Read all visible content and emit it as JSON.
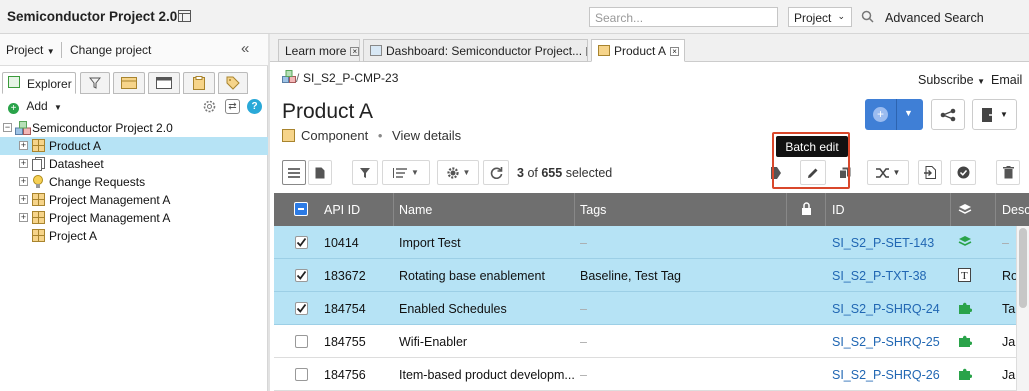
{
  "app": {
    "title": "Semiconductor Project 2.0"
  },
  "search": {
    "placeholder": "Search...",
    "scope": "Project",
    "advanced": "Advanced Search"
  },
  "left": {
    "project_menu": "Project",
    "change_project": "Change project",
    "explorer_tab": "Explorer",
    "add": "Add",
    "tree": [
      {
        "label": "Semiconductor Project 2.0",
        "icon": "project-icon",
        "level": 0,
        "expander": "−"
      },
      {
        "label": "Product A",
        "icon": "component-icon",
        "level": 1,
        "expander": "+",
        "selected": true
      },
      {
        "label": "Datasheet",
        "icon": "document-icon",
        "level": 1,
        "expander": "+"
      },
      {
        "label": "Change Requests",
        "icon": "lightbulb-icon",
        "level": 1,
        "expander": "+"
      },
      {
        "label": "Project Management A",
        "icon": "component-icon",
        "level": 1,
        "expander": "+"
      },
      {
        "label": "Project Management A",
        "icon": "component-icon",
        "level": 1,
        "expander": "+"
      },
      {
        "label": "Project A",
        "icon": "component-icon",
        "level": 1,
        "expander": ""
      }
    ]
  },
  "tabs": [
    {
      "label": "Learn more"
    },
    {
      "label": "Dashboard: Semiconductor Project..."
    },
    {
      "label": "Product A",
      "active": true
    }
  ],
  "header": {
    "breadcrumb": "SI_S2_P-CMP-23",
    "subscribe": "Subscribe",
    "email": "Email",
    "title": "Product A",
    "type": "Component",
    "separator": "•",
    "view_details": "View details"
  },
  "toolbar": {
    "selection_count": "3",
    "selection_of": "of",
    "selection_total": "655",
    "selection_word": "selected",
    "tooltip": "Batch edit"
  },
  "table": {
    "columns": [
      "API ID",
      "Name",
      "Tags",
      "",
      "ID",
      "",
      "Desc"
    ],
    "rows": [
      {
        "checked": true,
        "api_id": "10414",
        "name": "Import Test",
        "tags": "–",
        "id": "SI_S2_P-SET-143",
        "type_icon": "set-icon",
        "desc": "–"
      },
      {
        "checked": true,
        "api_id": "183672",
        "name": "Rotating base enablement",
        "tags": "Baseline, Test Tag",
        "id": "SI_S2_P-TXT-38",
        "type_icon": "text-icon",
        "desc": "Ro"
      },
      {
        "checked": true,
        "api_id": "184754",
        "name": "Enabled Schedules",
        "tags": "–",
        "id": "SI_S2_P-SHRQ-24",
        "type_icon": "puzzle-icon",
        "desc": "Ta"
      },
      {
        "checked": false,
        "api_id": "184755",
        "name": "Wifi-Enabler",
        "tags": "–",
        "id": "SI_S2_P-SHRQ-25",
        "type_icon": "puzzle-icon",
        "desc": "Ja"
      },
      {
        "checked": false,
        "api_id": "184756",
        "name": "Item-based product developm...",
        "tags": "–",
        "id": "SI_S2_P-SHRQ-26",
        "type_icon": "puzzle-icon",
        "desc": "Ja"
      }
    ]
  },
  "colors": {
    "accent": "#3f7fd6",
    "selected_row": "#b6e3f5",
    "header_bg": "#6f6f6f",
    "highlight": "#d9472b",
    "link": "#2167b3"
  }
}
